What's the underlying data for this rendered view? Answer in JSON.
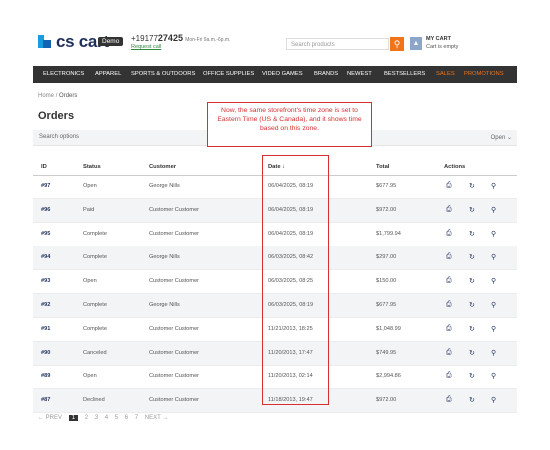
{
  "header": {
    "logo_text": "cs cart",
    "demo_badge": "Demo",
    "phone_prefix": "+19177",
    "phone_bold": "27425",
    "hours": "Mon-Fri 9a.m.-6p.m.",
    "request_call": "Request call",
    "search_placeholder": "Search products",
    "cart_title": "MY CART",
    "cart_status": "Cart is empty"
  },
  "nav": [
    "ELECTRONICS",
    "APPAREL",
    "SPORTS & OUTDOORS",
    "OFFICE SUPPLIES",
    "VIDEO GAMES",
    "BRANDS",
    "NEWEST",
    "BESTSELLERS",
    "SALES",
    "PROMOTIONS"
  ],
  "breadcrumb": {
    "home": "Home",
    "sep": "/",
    "current": "Orders"
  },
  "page_title": "Orders",
  "search_options": {
    "label": "Search options",
    "toggle": "Open ⌄"
  },
  "table": {
    "headers": {
      "id": "ID",
      "status": "Status",
      "customer": "Customer",
      "date": "Date ↓",
      "total": "Total",
      "actions": "Actions"
    },
    "rows": [
      {
        "id": "#97",
        "status": "Open",
        "customer": "George Nills",
        "date": "06/04/2025, 08:19",
        "total": "$677.95"
      },
      {
        "id": "#96",
        "status": "Paid",
        "customer": "Customer Customer",
        "date": "06/04/2025, 08:19",
        "total": "$972.00"
      },
      {
        "id": "#95",
        "status": "Complete",
        "customer": "Customer Customer",
        "date": "06/04/2025, 08:19",
        "total": "$1,799.94"
      },
      {
        "id": "#94",
        "status": "Complete",
        "customer": "George Nills",
        "date": "06/03/2025, 08:42",
        "total": "$297.00"
      },
      {
        "id": "#93",
        "status": "Open",
        "customer": "Customer Customer",
        "date": "06/03/2025, 08:25",
        "total": "$150.00"
      },
      {
        "id": "#92",
        "status": "Complete",
        "customer": "George Nills",
        "date": "06/03/2025, 08:19",
        "total": "$677.95"
      },
      {
        "id": "#91",
        "status": "Complete",
        "customer": "Customer Customer",
        "date": "11/21/2013, 18:25",
        "total": "$1,048.99"
      },
      {
        "id": "#90",
        "status": "Canceled",
        "customer": "Customer Customer",
        "date": "11/20/2013, 17:47",
        "total": "$749.95"
      },
      {
        "id": "#89",
        "status": "Open",
        "customer": "Customer Customer",
        "date": "11/20/2013, 02:14",
        "total": "$2,994.86"
      },
      {
        "id": "#87",
        "status": "Declined",
        "customer": "Customer Customer",
        "date": "11/18/2013, 19:47",
        "total": "$972.00"
      }
    ]
  },
  "annotation": "Now, the same storefront's time zone is set to Eastern Time (US & Canada), and it shows time based on this zone.",
  "pagination": {
    "prev": "← PREV",
    "pages": [
      "1",
      "2",
      "3",
      "4",
      "5",
      "6",
      "7"
    ],
    "next": "NEXT →"
  },
  "colors": {
    "accent": "#f0751a",
    "nav_bg": "#333333",
    "highlight": "#d63031",
    "brand": "#1d2f5a"
  }
}
